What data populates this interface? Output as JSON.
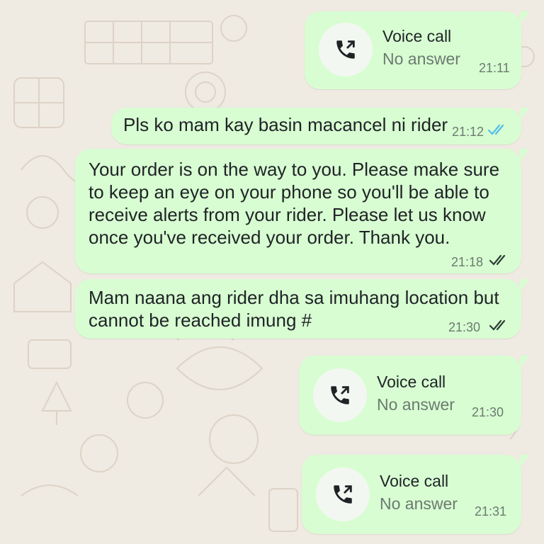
{
  "icons": {
    "call": "outgoing-call-icon",
    "read_receipt": "double-check-icon"
  },
  "colors": {
    "bubble": "#d8fdd2",
    "wallpaper": "#efeae2",
    "read_tick_blue": "#53bdeb",
    "delivered_tick_gray": "#2c3e35"
  },
  "messages": [
    {
      "type": "call",
      "title": "Voice call",
      "status": "No answer",
      "time": "21:11"
    },
    {
      "type": "text",
      "direction": "outgoing",
      "text": "Pls ko mam kay basin macancel ni rider",
      "time": "21:12",
      "receipt": "read"
    },
    {
      "type": "text",
      "direction": "outgoing",
      "lines": [
        "Your order is on the way to you. Please make sure",
        "to keep an eye on your phone so you'll be able to",
        "receive alerts from your rider. Please let us know",
        "once you've received your order. Thank you."
      ],
      "time": "21:18",
      "receipt": "delivered"
    },
    {
      "type": "text",
      "direction": "outgoing",
      "lines": [
        "Mam naana ang rider dha sa imuhang location but",
        "cannot be reached imung #"
      ],
      "time": "21:30",
      "receipt": "delivered"
    },
    {
      "type": "call",
      "title": "Voice call",
      "status": "No answer",
      "time": "21:30"
    },
    {
      "type": "call",
      "title": "Voice call",
      "status": "No answer",
      "time": "21:31"
    }
  ]
}
